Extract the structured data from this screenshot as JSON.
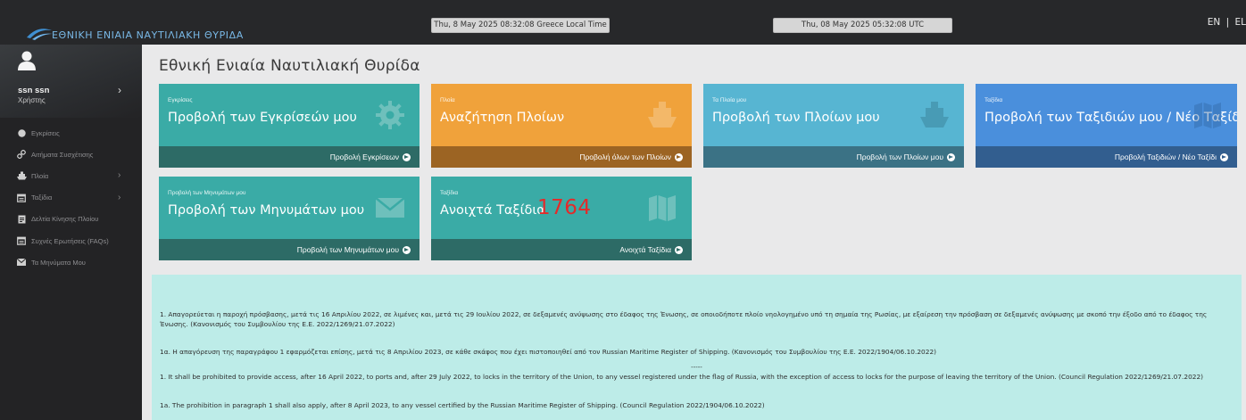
{
  "header": {
    "logo_text": "ΕΘΝΙΚΗ ΕΝΙΑΙΑ ΝΑΥΤΙΛΙΑΚΗ ΘΥΡΙΔΑ",
    "local_time": "Thu, 8 May 2025 08:32:08 Greece Local Time",
    "utc_time": "Thu, 08 May 2025 05:32:08 UTC",
    "lang_en": "EN",
    "lang_sep": "|",
    "lang_el": "EL"
  },
  "user": {
    "name": "ssn ssn",
    "role": "Χρήστης"
  },
  "sidebar": {
    "items": [
      {
        "label": "Εγκρίσεις",
        "icon": "circle-icon",
        "has_submenu": false
      },
      {
        "label": "Αιτήματα Συσχέτισης",
        "icon": "link-icon",
        "has_submenu": false
      },
      {
        "label": "Πλοία",
        "icon": "ship-icon",
        "has_submenu": true
      },
      {
        "label": "Ταξίδια",
        "icon": "calendar-icon",
        "has_submenu": true
      },
      {
        "label": "Δελτία Κίνησης Πλοίου",
        "icon": "document-icon",
        "has_submenu": false
      },
      {
        "label": "Συχνές Ερωτήσεις (FAQs)",
        "icon": "calendar-icon",
        "has_submenu": false
      },
      {
        "label": "Τα Μηνύματα Μου",
        "icon": "envelope-icon",
        "has_submenu": false
      }
    ]
  },
  "page": {
    "title": "Εθνική Ενιαία Ναυτιλιακή Θυρίδα"
  },
  "cards": [
    {
      "small": "Εγκρίσεις",
      "big": "Προβολή των Εγκρίσεών μου",
      "footer": "Προβολή Εγκρίσεων",
      "icon": "gear-icon",
      "color": "#3aaba6",
      "footer_color": "#2d6b66"
    },
    {
      "small": "Πλοία",
      "big": "Αναζήτηση Πλοίων",
      "footer": "Προβολή όλων των Πλοίων",
      "icon": "ship-icon",
      "color": "#f0a23b",
      "footer_color": "#9c6423"
    },
    {
      "small": "Τα Πλοία μου",
      "big": "Προβολή των Πλοίων μου",
      "footer": "Προβολή των Πλοίων μου",
      "icon": "ship-icon",
      "color": "#57b5d2",
      "footer_color": "#3b7285"
    },
    {
      "small": "Ταξίδια",
      "big": "Προβολή των Ταξιδιών μου / Νέο Ταξίδι",
      "footer": "Προβολή Ταξιδιών / Νέο Ταξίδι",
      "icon": "map-icon",
      "color": "#4a8fdc",
      "footer_color": "#325e8f"
    },
    {
      "small": "Προβολή των Μηνυμάτων μου",
      "big": "Προβολή των Μηνυμάτων μου",
      "footer": "Προβολή των Μηνυμάτων μου",
      "icon": "envelope-icon",
      "color": "#3aaba6",
      "footer_color": "#2d6b66"
    },
    {
      "small": "Ταξίδια",
      "big": "Ανοιχτά Ταξίδια",
      "count": "1764",
      "footer": "Ανοιχτά Ταξίδια",
      "icon": "map-icon",
      "color": "#3aaba6",
      "footer_color": "#2d6b66"
    }
  ],
  "notice": {
    "p1": "1. Απαγορεύεται η παροχή πρόσβασης, μετά τις 16 Απριλίου 2022, σε λιμένες και, μετά τις 29 Ιουλίου 2022, σε δεξαμενές ανύψωσης στο έδαφος της Ένωσης, σε οποιοδήποτε πλοίο νηολογημένο υπό τη σημαία της Ρωσίας, με εξαίρεση την πρόσβαση σε δεξαμενές ανύψωσης με σκοπό την έξοδο από το έδαφος της Ένωσης. (Κανονισμός του Συμβουλίου της Ε.Ε. 2022/1269/21.07.2022)",
    "p2": "1α. Η απαγόρευση της παραγράφου 1 εφαρμόζεται επίσης, μετά τις 8 Απριλίου 2023, σε κάθε σκάφος που έχει πιστοποιηθεί από τον Russian Maritime Register of Shipping. (Κανονισμός του Συμβουλίου της Ε.Ε. 2022/1904/06.10.2022)",
    "divider": "-----",
    "p3": "1. It shall be prohibited to provide access, after 16 April 2022, to ports and, after 29 July 2022, to locks in the territory of the Union, to any vessel registered under the flag of Russia, with the exception of access to locks for the purpose of leaving the territory of the Union. (Council Regulation 2022/1269/21.07.2022)",
    "p4": "1a. The prohibition in paragraph 1 shall also apply, after 8 April 2023, to any vessel certified by the Russian Maritime Register of Shipping. (Council Regulation 2022/1904/06.10.2022)"
  }
}
